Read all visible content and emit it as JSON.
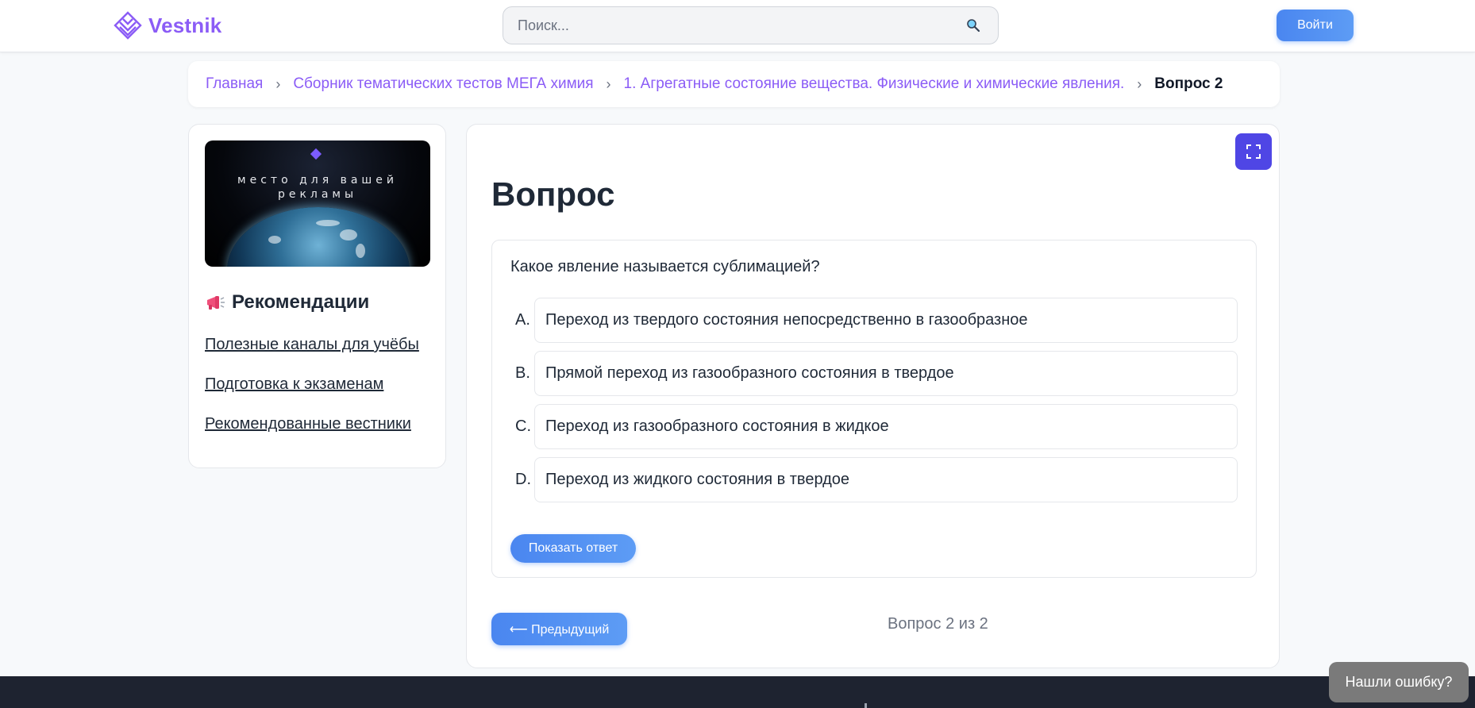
{
  "header": {
    "logo_text": "Vestnik",
    "search_placeholder": "Поиск...",
    "login_label": "Войти"
  },
  "breadcrumb": {
    "items": [
      "Главная",
      "Сборник тематических тестов МЕГА химия",
      "1. Агрегатные состояние вещества. Физические и химические явления."
    ],
    "current": "Вопрос 2",
    "separator": "›"
  },
  "sidebar": {
    "ad_text_line1": "место для вашей",
    "ad_text_line2": "рекламы",
    "recommendations_title": "Рекомендации",
    "links": [
      "Полезные каналы для учёбы",
      "Подготовка к экзаменам",
      "Рекомендованные вестники"
    ]
  },
  "main": {
    "title": "Вопрос",
    "question": "Какое явление называется сублимацией?",
    "options": [
      {
        "letter": "A.",
        "text": "Переход из твердого состояния непосредственно в газообразное"
      },
      {
        "letter": "B.",
        "text": "Прямой переход из газообразного состояния в твердое"
      },
      {
        "letter": "C.",
        "text": "Переход из газообразного состояния в жидкое"
      },
      {
        "letter": "D.",
        "text": "Переход из жидкого состояния в твердое"
      }
    ],
    "show_answer_label": "Показать ответ",
    "prev_label": "⟵ Предыдущий",
    "counter": "Вопрос 2 из 2"
  },
  "report_label": "Нашли ошибку?",
  "colors": {
    "accent": "#8b5cf6",
    "button_blue": "#4a86f0",
    "fullscreen": "#4f46e5",
    "footer": "#1e2330"
  }
}
